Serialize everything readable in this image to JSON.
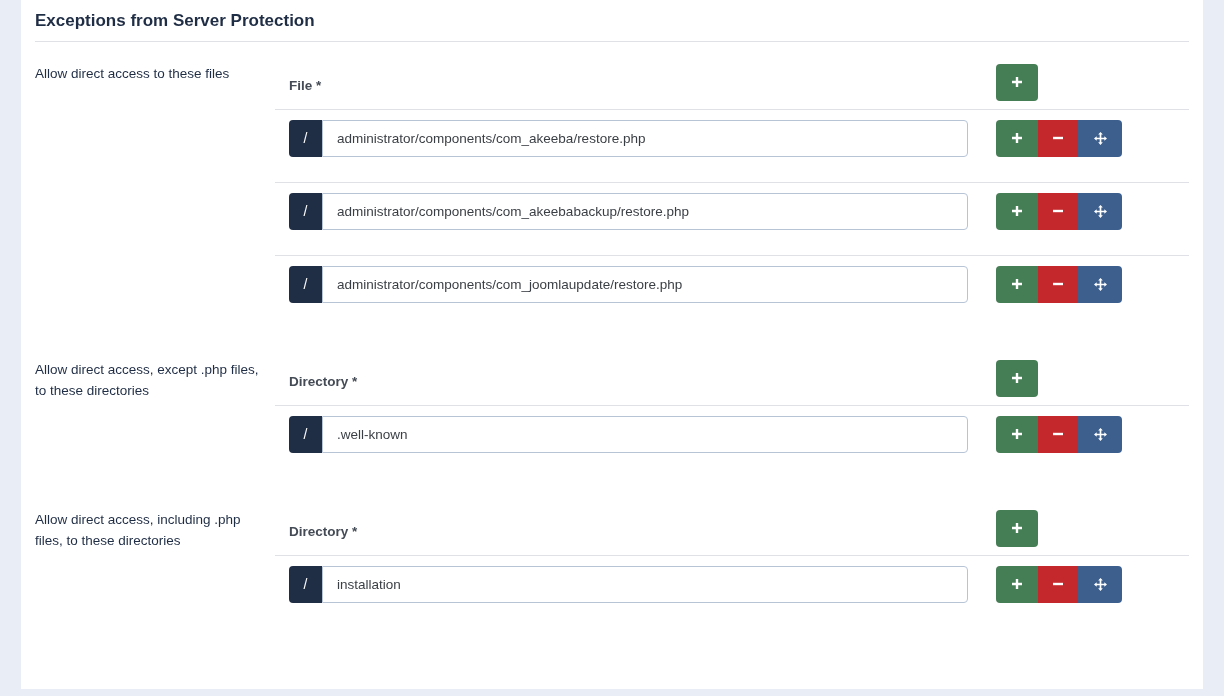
{
  "title": "Exceptions from Server Protection",
  "sections": [
    {
      "label": "Allow direct access to these files",
      "column": "File *",
      "prefix": "/",
      "rows": [
        "administrator/components/com_akeeba/restore.php",
        "administrator/components/com_akeebabackup/restore.php",
        "administrator/components/com_joomlaupdate/restore.php"
      ]
    },
    {
      "label": "Allow direct access, except .php files, to these directories",
      "column": "Directory *",
      "prefix": "/",
      "rows": [
        ".well-known"
      ]
    },
    {
      "label": "Allow direct access, including .php files, to these directories",
      "column": "Directory *",
      "prefix": "/",
      "rows": [
        "installation"
      ]
    }
  ]
}
